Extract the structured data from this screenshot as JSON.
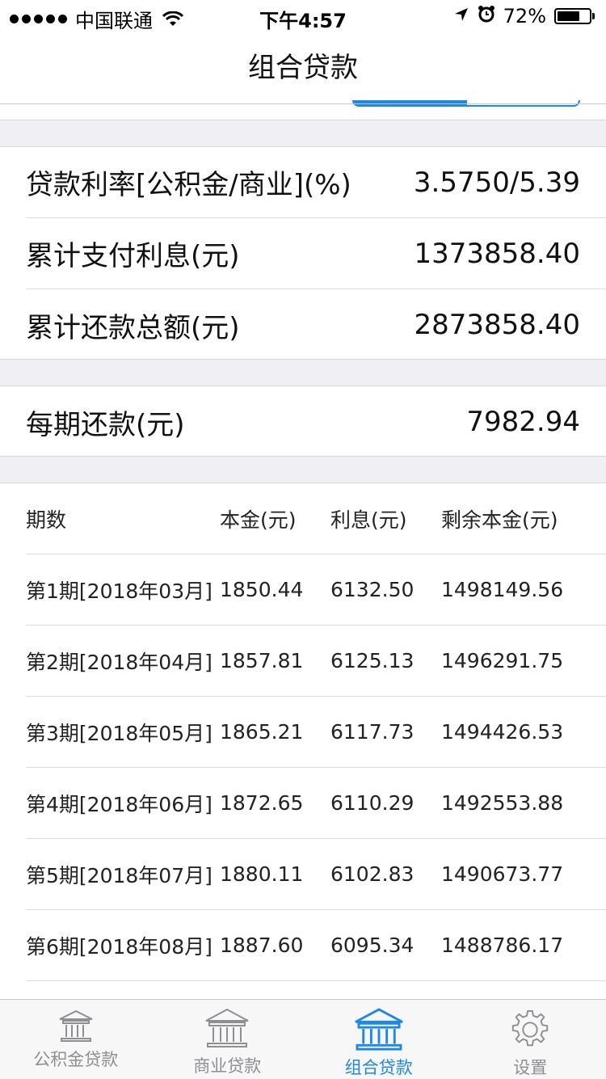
{
  "status_bar": {
    "carrier": "中国联通",
    "time": "下午4:57",
    "battery_percent": "72%",
    "battery_level": 0.72
  },
  "nav": {
    "title": "组合贷款"
  },
  "summary": {
    "rate_label": "贷款利率[公积金/商业](%)",
    "rate_value": "3.5750/5.39",
    "interest_label": "累计支付利息(元)",
    "interest_value": "1373858.40",
    "total_label": "累计还款总额(元)",
    "total_value": "2873858.40"
  },
  "monthly": {
    "label": "每期还款(元)",
    "value": "7982.94"
  },
  "table": {
    "headers": [
      "期数",
      "本金(元)",
      "利息(元)",
      "剩余本金(元)"
    ],
    "rows": [
      [
        "第1期[2018年03月]",
        "1850.44",
        "6132.50",
        "1498149.56"
      ],
      [
        "第2期[2018年04月]",
        "1857.81",
        "6125.13",
        "1496291.75"
      ],
      [
        "第3期[2018年05月]",
        "1865.21",
        "6117.73",
        "1494426.53"
      ],
      [
        "第4期[2018年06月]",
        "1872.65",
        "6110.29",
        "1492553.88"
      ],
      [
        "第5期[2018年07月]",
        "1880.11",
        "6102.83",
        "1490673.77"
      ],
      [
        "第6期[2018年08月]",
        "1887.60",
        "6095.34",
        "1488786.17"
      ]
    ]
  },
  "tabs": [
    {
      "label": "公积金贷款",
      "icon": "bank-icon",
      "active": false
    },
    {
      "label": "商业贷款",
      "icon": "bank-icon",
      "active": false
    },
    {
      "label": "组合贷款",
      "icon": "bank-icon",
      "active": true
    },
    {
      "label": "设置",
      "icon": "gear-icon",
      "active": false
    }
  ],
  "colors": {
    "accent": "#1e88e5",
    "inactive": "#8e8e93",
    "separator_bg": "#efeff4"
  }
}
